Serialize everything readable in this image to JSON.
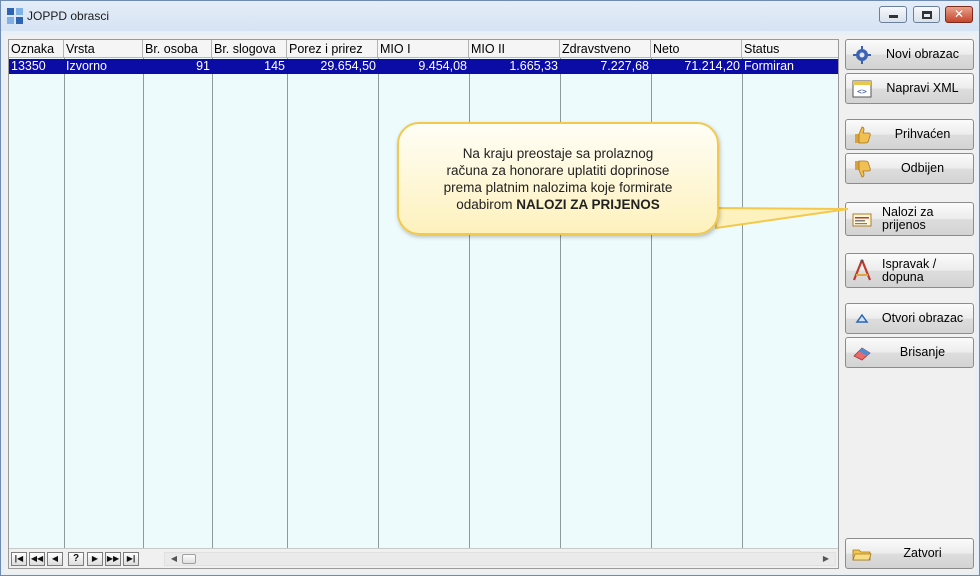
{
  "window": {
    "title": "JOPPD obrasci"
  },
  "grid": {
    "columns": [
      {
        "key": "oznaka",
        "label": "Oznaka"
      },
      {
        "key": "vrsta",
        "label": "Vrsta"
      },
      {
        "key": "br_osoba",
        "label": "Br. osoba"
      },
      {
        "key": "br_slogova",
        "label": "Br. slogova"
      },
      {
        "key": "porez",
        "label": "Porez i prirez"
      },
      {
        "key": "mio1",
        "label": "MIO I"
      },
      {
        "key": "mio2",
        "label": "MIO II"
      },
      {
        "key": "zdravstveno",
        "label": "Zdravstveno"
      },
      {
        "key": "neto",
        "label": "Neto"
      },
      {
        "key": "status",
        "label": "Status"
      }
    ],
    "rows": [
      {
        "oznaka": "13350",
        "vrsta": "Izvorno",
        "br_osoba": "91",
        "br_slogova": "145",
        "porez": "29.654,50",
        "mio1": "9.454,08",
        "mio2": "1.665,33",
        "zdravstveno": "7.227,68",
        "neto": "71.214,20",
        "status": "Formiran"
      }
    ],
    "navigator": [
      "first-record-icon",
      "prev-page-icon",
      "prev-record-icon",
      "help-icon",
      "next-record-icon",
      "next-page-icon",
      "last-record-icon"
    ]
  },
  "buttons": {
    "novi_obrazac": "Novi obrazac",
    "napravi_xml": "Napravi XML",
    "prihvacen": "Prihvaćen",
    "odbijen": "Odbijen",
    "nalozi_1": "Nalozi za",
    "nalozi_2": "prijenos",
    "ispravak_1": "Ispravak /",
    "ispravak_2": "dopuna",
    "otvori_obrazac": "Otvori obrazac",
    "brisanje": "Brisanje",
    "zatvori": "Zatvori"
  },
  "callout": {
    "line1": "Na kraju preostaje sa prolaznog",
    "line2": "računa za honorare uplatiti doprinose",
    "line3": "prema platnim nalozima koje formirate",
    "line4_prefix": "odabirom ",
    "line4_bold": "NALOZI ZA PRIJENOS"
  },
  "colors": {
    "selection": "#0b0ba6",
    "grid_bg": "#eefbfd",
    "callout_border": "#f2c94c"
  }
}
